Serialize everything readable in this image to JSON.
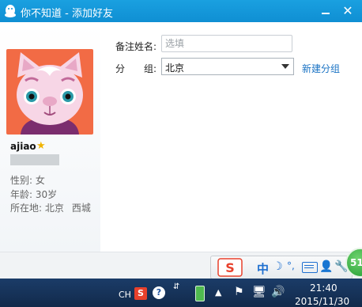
{
  "window": {
    "title": "你不知道 - 添加好友",
    "minimize_icon": "minimize-icon",
    "close_icon": "close-icon",
    "close_glyph": "✕"
  },
  "profile": {
    "username": "ajiao",
    "star_icon": "star-icon",
    "star_glyph": "★",
    "gender": "性别: 女",
    "age": "年龄: 30岁",
    "location_label": "所在地: 北京",
    "location_district": "西城"
  },
  "form": {
    "remark_label": "备注姓名:",
    "remark_placeholder": "选填",
    "remark_value": "",
    "group_label_left": "分",
    "group_label_right": "组:",
    "group_selected": "北京",
    "new_group_link": "新建分组"
  },
  "ime_toolbar": {
    "logo_icon": "sogou-s-logo-icon",
    "logo_letter": "S",
    "lang_mode": "中",
    "moon_glyph": "☽",
    "punct_glyph": "°,",
    "user_glyph": "👤",
    "tool_glyph": "🔧"
  },
  "badge": {
    "text": "51"
  },
  "taskbar": {
    "input_indicator": "CH",
    "sogou_tray": "S",
    "help_glyph": "?",
    "arrows_glyph": "⇵",
    "up_glyph": "▲",
    "flag_glyph": "⚑",
    "network_glyph": "🖥",
    "volume_glyph": "🔊",
    "time": "21:40",
    "date": "2015/11/30"
  },
  "colors": {
    "titlebar": "#1296db",
    "link": "#1a73c4",
    "avatar_bg": "#f26b45",
    "cat": "#f7d6e6",
    "taskbar": "#17335a"
  }
}
